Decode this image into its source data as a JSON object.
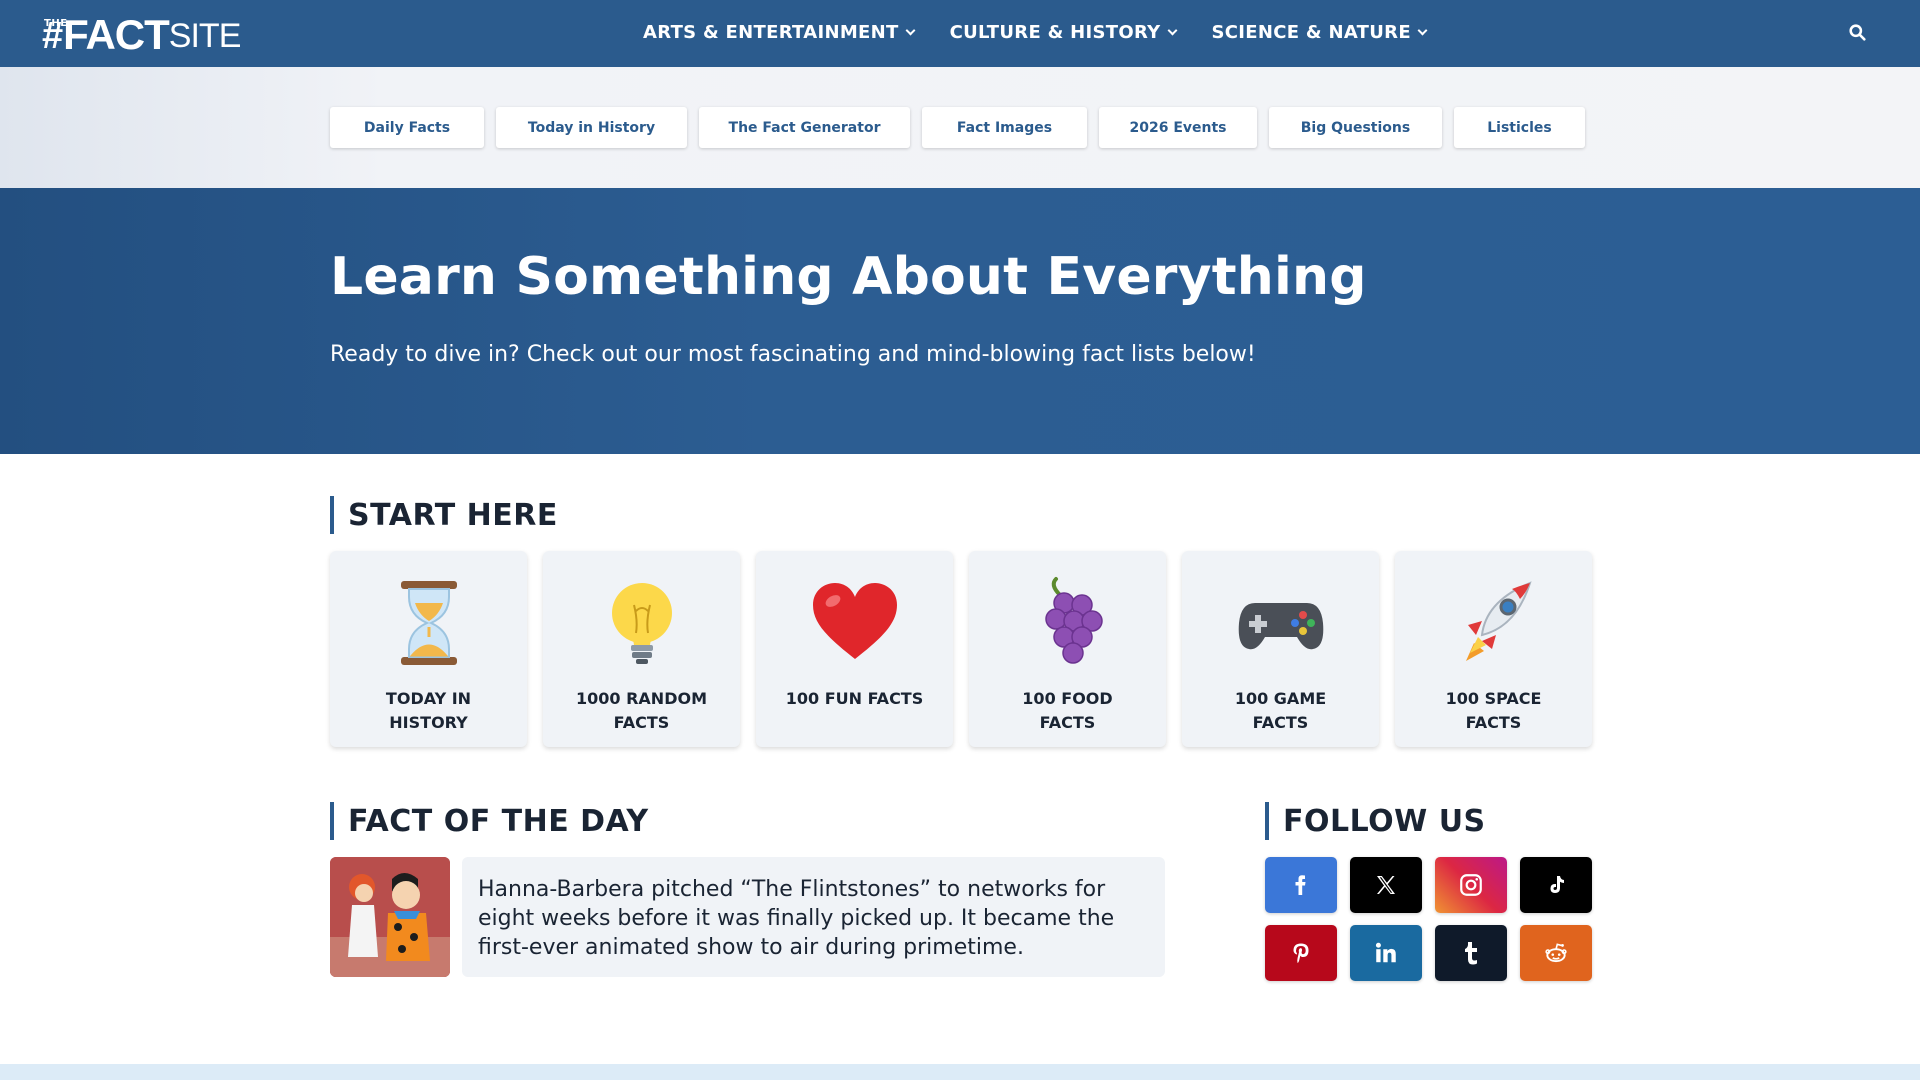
{
  "header": {
    "logo": {
      "the": "THE",
      "hash": "#",
      "fact": "FACT",
      "site": "SITE"
    },
    "nav": [
      {
        "label": "ARTS & ENTERTAINMENT"
      },
      {
        "label": "CULTURE & HISTORY"
      },
      {
        "label": "SCIENCE & NATURE"
      }
    ],
    "search_icon": "search-icon"
  },
  "subnav": [
    {
      "label": "Daily Facts"
    },
    {
      "label": "Today in History"
    },
    {
      "label": "The Fact Generator"
    },
    {
      "label": "Fact Images"
    },
    {
      "label": "2026 Events"
    },
    {
      "label": "Big Questions"
    },
    {
      "label": "Listicles"
    }
  ],
  "hero": {
    "title": "Learn Something About Everything",
    "subtitle": "Ready to dive in? Check out our most fascinating and mind-blowing fact lists below!"
  },
  "start_here": {
    "heading": "START HERE",
    "cards": [
      {
        "label": "TODAY IN HISTORY",
        "icon": "hourglass-icon"
      },
      {
        "label": "1000 RANDOM FACTS",
        "icon": "lightbulb-icon"
      },
      {
        "label": "100 FUN FACTS",
        "icon": "heart-icon"
      },
      {
        "label": "100 FOOD FACTS",
        "icon": "grapes-icon"
      },
      {
        "label": "100 GAME FACTS",
        "icon": "gamepad-icon"
      },
      {
        "label": "100 SPACE FACTS",
        "icon": "rocket-icon"
      }
    ]
  },
  "fact_of_day": {
    "heading": "FACT OF THE DAY",
    "text": "Hanna-Barbera pitched “The Flintstones” to networks for eight weeks before it was finally picked up. It became the first-ever animated show to air during primetime."
  },
  "follow_us": {
    "heading": "FOLLOW US",
    "networks": [
      {
        "icon": "facebook-icon",
        "color": "#3b77d8"
      },
      {
        "icon": "x-icon",
        "color": "#000000"
      },
      {
        "icon": "instagram-icon",
        "color": "#c13584"
      },
      {
        "icon": "tiktok-icon",
        "color": "#000000"
      },
      {
        "icon": "pinterest-icon",
        "color": "#b7081b"
      },
      {
        "icon": "linkedin-icon",
        "color": "#1a6aa0"
      },
      {
        "icon": "tumblr-icon",
        "color": "#0f1a2a"
      },
      {
        "icon": "reddit-icon",
        "color": "#e0641e"
      }
    ]
  },
  "colors": {
    "brand": "#2b5b8d",
    "card_bg": "#f0f3f7",
    "text": "#1a2433"
  }
}
